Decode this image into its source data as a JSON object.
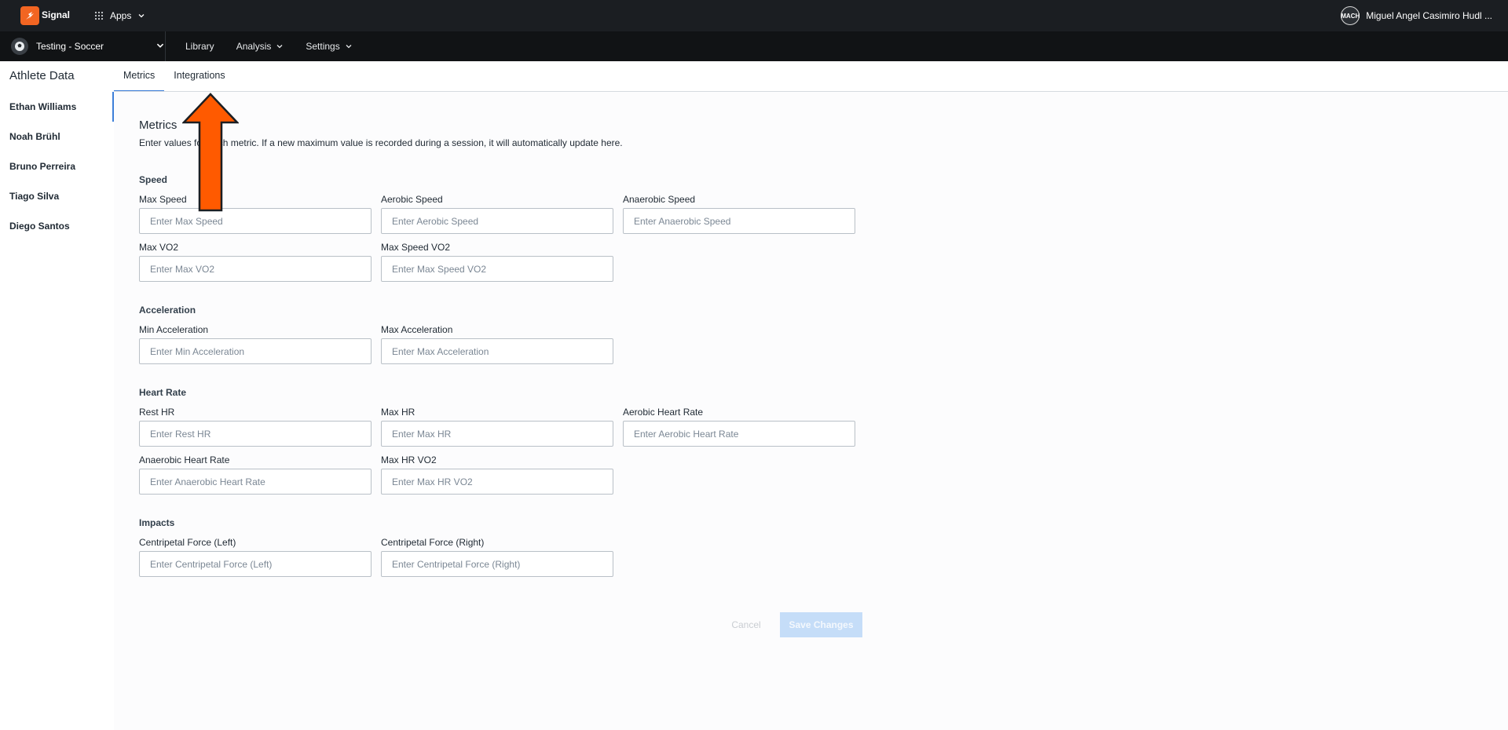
{
  "topbar": {
    "app_name": "Signal",
    "apps_label": "Apps",
    "user_name": "Miguel Angel Casimiro Hudl ...",
    "user_initials": "MACH"
  },
  "subbar": {
    "team_name": "Testing - Soccer",
    "nav": [
      {
        "label": "Library"
      },
      {
        "label": "Analysis"
      },
      {
        "label": "Settings"
      }
    ]
  },
  "page": {
    "section_title": "Athlete Data",
    "tabs": [
      {
        "label": "Metrics"
      },
      {
        "label": "Integrations"
      }
    ]
  },
  "athletes": [
    "Ethan Williams",
    "Noah Brühl",
    "Bruno Perreira",
    "Tiago Silva",
    "Diego Santos"
  ],
  "metrics": {
    "title": "Metrics",
    "description": "Enter values for each metric. If a new maximum value is recorded during a session, it will automatically update here.",
    "groups": [
      {
        "title": "Speed",
        "fields": [
          {
            "label": "Max Speed",
            "placeholder": "Enter Max Speed"
          },
          {
            "label": "Aerobic Speed",
            "placeholder": "Enter Aerobic Speed"
          },
          {
            "label": "Anaerobic Speed",
            "placeholder": "Enter Anaerobic Speed"
          },
          {
            "label": "Max VO2",
            "placeholder": "Enter Max VO2"
          },
          {
            "label": "Max Speed VO2",
            "placeholder": "Enter Max Speed VO2"
          }
        ]
      },
      {
        "title": "Acceleration",
        "fields": [
          {
            "label": "Min Acceleration",
            "placeholder": "Enter Min Acceleration"
          },
          {
            "label": "Max Acceleration",
            "placeholder": "Enter Max Acceleration"
          }
        ]
      },
      {
        "title": "Heart Rate",
        "fields": [
          {
            "label": "Rest HR",
            "placeholder": "Enter Rest HR"
          },
          {
            "label": "Max HR",
            "placeholder": "Enter Max HR"
          },
          {
            "label": "Aerobic Heart Rate",
            "placeholder": "Enter Aerobic Heart Rate"
          },
          {
            "label": "Anaerobic Heart Rate",
            "placeholder": "Enter Anaerobic Heart Rate"
          },
          {
            "label": "Max HR VO2",
            "placeholder": "Enter Max HR VO2"
          }
        ]
      },
      {
        "title": "Impacts",
        "fields": [
          {
            "label": "Centripetal Force (Left)",
            "placeholder": "Enter Centripetal Force (Left)"
          },
          {
            "label": "Centripetal Force (Right)",
            "placeholder": "Enter Centripetal Force (Right)"
          }
        ]
      }
    ]
  },
  "actions": {
    "cancel": "Cancel",
    "save": "Save Changes"
  },
  "colors": {
    "brand": "#f26522",
    "accent": "#3d7fd9",
    "topbar": "#1b1e22",
    "subbar": "#111315",
    "save_disabled": "#c5ddf8",
    "annotation_arrow": "#ff5a00"
  }
}
